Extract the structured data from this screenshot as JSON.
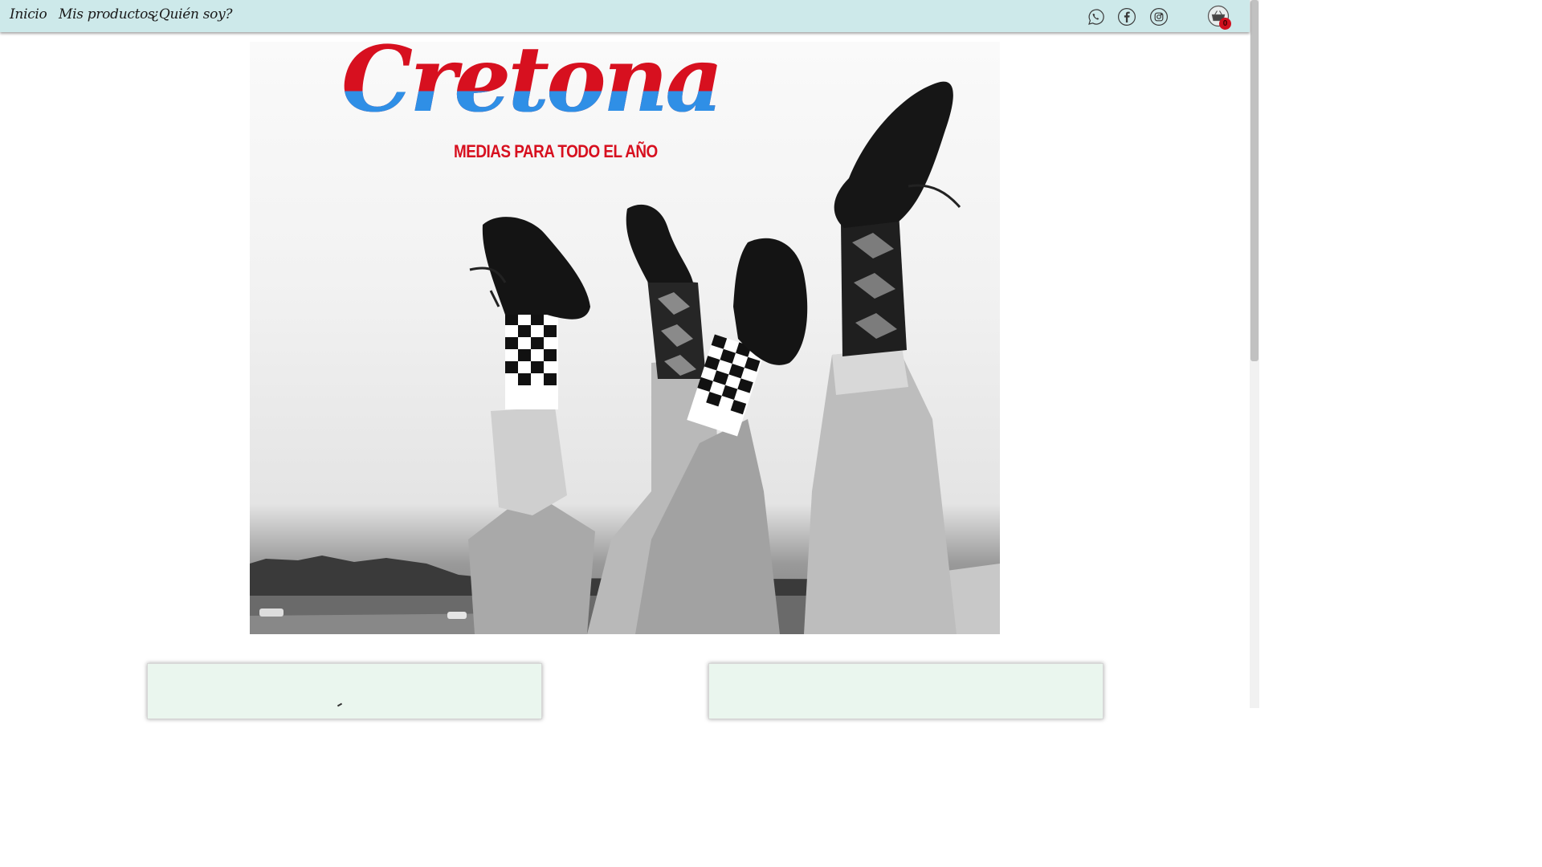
{
  "nav": {
    "links": [
      "Inicio",
      "Mis productos",
      "¿Quién soy?"
    ]
  },
  "social": {
    "icons": [
      "whatsapp-icon",
      "facebook-icon",
      "instagram-icon"
    ]
  },
  "cart": {
    "icon": "basket-icon",
    "count": "0"
  },
  "hero": {
    "brand": "Cretona",
    "tagline": "MEDIAS PARA TODO EL AÑO"
  },
  "colors": {
    "navbar_bg": "#cde9ea",
    "brand_red": "#d7101f",
    "brand_blue": "#2f8fe6",
    "card_bg": "#eaf6ee",
    "badge": "#d0101e"
  }
}
